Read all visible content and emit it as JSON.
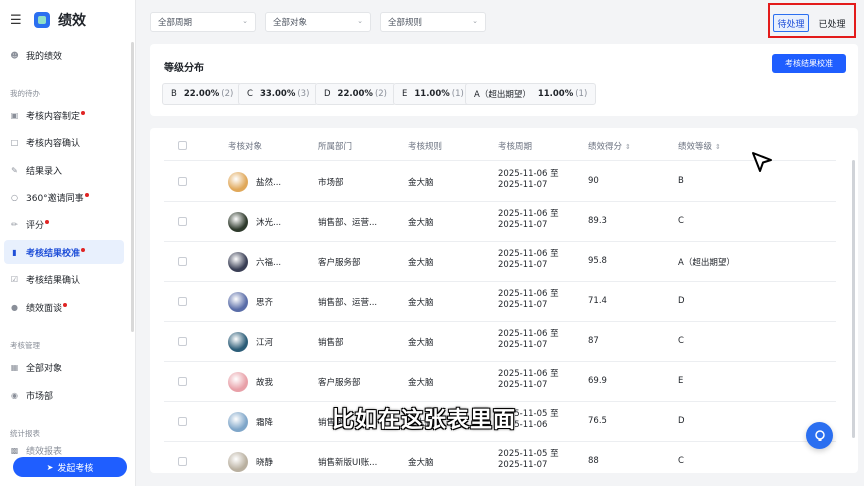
{
  "brand": {
    "title": "绩效"
  },
  "sidebar": {
    "items": [
      {
        "label": "我的绩效",
        "dot": false,
        "active": false,
        "icon": "user-icon"
      },
      {
        "label": "考核内容制定",
        "dot": true,
        "active": false,
        "icon": "lock-icon"
      },
      {
        "label": "考核内容确认",
        "dot": false,
        "active": false,
        "icon": "clipboard-icon"
      },
      {
        "label": "结果录入",
        "dot": false,
        "active": false,
        "icon": "pencil-icon"
      },
      {
        "label": "360°邀请同事",
        "dot": true,
        "active": false,
        "icon": "chat-icon"
      },
      {
        "label": "评分",
        "dot": true,
        "active": false,
        "icon": "edit-icon"
      },
      {
        "label": "考核结果校准",
        "dot": true,
        "active": true,
        "icon": "bookmark-icon"
      },
      {
        "label": "考核结果确认",
        "dot": false,
        "active": false,
        "icon": "clipboard-check-icon"
      },
      {
        "label": "绩效面谈",
        "dot": true,
        "active": false,
        "icon": "comment-icon"
      }
    ],
    "groups": {
      "todo": "我的待办",
      "manage": "考核管理",
      "report": "统计报表"
    },
    "manage_items": [
      {
        "label": "全部对象",
        "icon": "grid-icon"
      },
      {
        "label": "市场部",
        "icon": "department-icon"
      }
    ],
    "report_partial": "绩效报表",
    "launch_label": "发起考核"
  },
  "filters": {
    "period": "全部周期",
    "target": "全部对象",
    "rule": "全部规则"
  },
  "toggle": {
    "pending": "待处理",
    "done": "已处理"
  },
  "grade": {
    "title": "等级分布",
    "calibrate_label": "考核结果校准",
    "chips": [
      {
        "grade": "B",
        "pct": "22.00%",
        "count": "(2)"
      },
      {
        "grade": "C",
        "pct": "33.00%",
        "count": "(3)"
      },
      {
        "grade": "D",
        "pct": "22.00%",
        "count": "(2)"
      },
      {
        "grade": "E",
        "pct": "11.00%",
        "count": "(1)"
      },
      {
        "grade": "A（超出期望）",
        "pct": "11.00%",
        "count": "(1)"
      }
    ]
  },
  "table": {
    "headers": {
      "target": "考核对象",
      "dept": "所属部门",
      "rule": "考核规则",
      "period": "考核周期",
      "score": "绩效得分",
      "level": "绩效等级"
    },
    "rows": [
      {
        "name": "盐然...",
        "dept": "市场部",
        "rule": "金大脑",
        "start": "2025-11-06 至",
        "end": "2025-11-07",
        "score": "90",
        "level": "B",
        "avatar_color": "#e0a85a"
      },
      {
        "name": "沐光...",
        "dept": "销售部、运营...",
        "rule": "金大脑",
        "start": "2025-11-06 至",
        "end": "2025-11-07",
        "score": "89.3",
        "level": "C",
        "avatar_color": "#2e3a2c"
      },
      {
        "name": "六福...",
        "dept": "客户服务部",
        "rule": "金大脑",
        "start": "2025-11-06 至",
        "end": "2025-11-07",
        "score": "95.8",
        "level": "A（超出期望）",
        "avatar_color": "#3a3f55"
      },
      {
        "name": "思齐",
        "dept": "销售部、运营...",
        "rule": "金大脑",
        "start": "2025-11-06 至",
        "end": "2025-11-07",
        "score": "71.4",
        "level": "D",
        "avatar_color": "#5a6da8"
      },
      {
        "name": "江河",
        "dept": "销售部",
        "rule": "金大脑",
        "start": "2025-11-06 至",
        "end": "2025-11-07",
        "score": "87",
        "level": "C",
        "avatar_color": "#2c5d78"
      },
      {
        "name": "故我",
        "dept": "客户服务部",
        "rule": "金大脑",
        "start": "2025-11-06 至",
        "end": "2025-11-07",
        "score": "69.9",
        "level": "E",
        "avatar_color": "#e8a0a8"
      },
      {
        "name": "霜降",
        "dept": "销售部",
        "rule": "金大脑",
        "start": "2025-11-05 至",
        "end": "2025-11-06",
        "score": "76.5",
        "level": "D",
        "avatar_color": "#7fa6c9"
      },
      {
        "name": "晓静",
        "dept": "销售新版UI账...",
        "rule": "金大脑",
        "start": "2025-11-05 至",
        "end": "2025-11-07",
        "score": "88",
        "level": "C",
        "avatar_color": "#b9b0a0"
      }
    ]
  },
  "caption": "比如在这张表里面"
}
